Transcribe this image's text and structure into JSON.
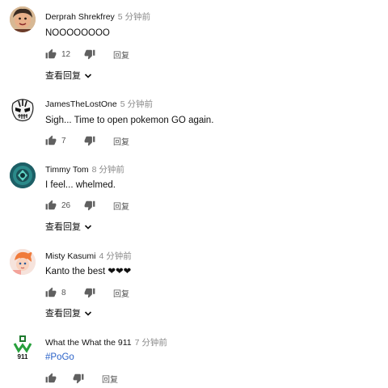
{
  "comments": [
    {
      "author": "Derprah Shrekfrey",
      "time": "5 分钟前",
      "text": "NOOOOOOOO",
      "likes": "12",
      "reply_label": "回复",
      "view_replies": "查看回复"
    },
    {
      "author": "JamesTheLostOne",
      "time": "5 分钟前",
      "text": "Sigh... Time to open pokemon GO again.",
      "likes": "7",
      "reply_label": "回复",
      "view_replies": ""
    },
    {
      "author": "Timmy Tom",
      "time": "8 分钟前",
      "text": "I feel... whelmed.",
      "likes": "26",
      "reply_label": "回复",
      "view_replies": "查看回复"
    },
    {
      "author": "Misty Kasumi",
      "time": "4 分钟前",
      "text": "Kanto the best ❤❤❤",
      "likes": "8",
      "reply_label": "回复",
      "view_replies": "查看回复"
    },
    {
      "author": "What the What the 911",
      "time": "7 分钟前",
      "text": "#PoGo",
      "likes": "",
      "reply_label": "回复",
      "view_replies": ""
    }
  ],
  "avatars": {
    "avatar_5_label": "911"
  },
  "icons": {
    "like": "thumbs-up-icon",
    "dislike": "thumbs-down-icon",
    "expand": "chevron-down-icon"
  },
  "colors": {
    "link": "#2a62c8",
    "time": "#8a8a8a",
    "icon": "#606060"
  }
}
